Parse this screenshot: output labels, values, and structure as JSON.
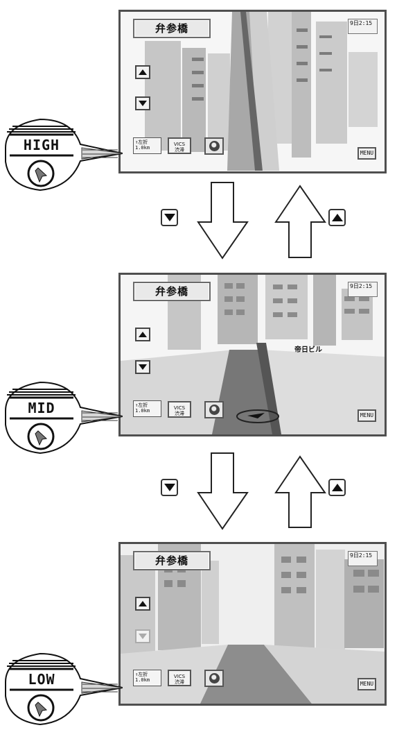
{
  "screens": [
    {
      "title": "弁参橋",
      "clock_text": "9日2:15",
      "distance_text": "↑左折\n1.0km",
      "vics_text": "VICS\n渋滞",
      "menu_text": "MENU"
    },
    {
      "title": "弁参橋",
      "clock_text": "9日2:15",
      "distance_text": "↑左折\n1.0km",
      "vics_text": "VICS\n渋滞",
      "menu_text": "MENU",
      "landmark_text": "帝日ビル"
    },
    {
      "title": "弁参橋",
      "clock_text": "9日2:15",
      "distance_text": "↑左折\n1.0km",
      "vics_text": "VICS\n渋滞",
      "menu_text": "MENU"
    }
  ],
  "levels": [
    "HIGH",
    "MID",
    "LOW"
  ],
  "icons": {
    "transition_down": "arrow-down-icon",
    "transition_up": "arrow-up-icon",
    "view_down": "triangle-down-icon",
    "view_up": "triangle-up-icon",
    "zoom": "magnifier-icon"
  },
  "colors": {
    "frame": "#4f4f4f",
    "screen_background": "#f7f7f7",
    "road": "#8e8e8e",
    "building": "#c8c8c8"
  }
}
